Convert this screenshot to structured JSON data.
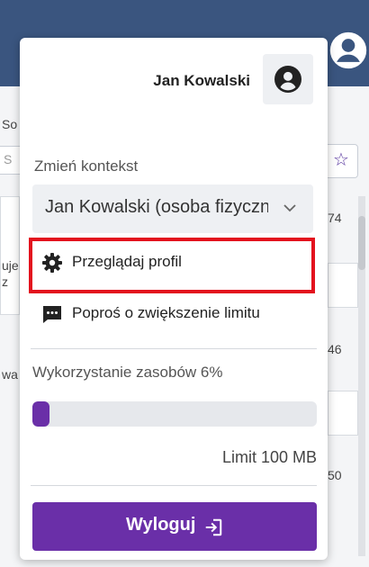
{
  "background": {
    "left_fragments": [
      "So",
      "S",
      "uje",
      "z",
      "wa"
    ],
    "numbers": [
      "74",
      "46",
      "50"
    ]
  },
  "dropdown": {
    "user_name": "Jan Kowalski",
    "context": {
      "label": "Zmień kontekst",
      "selected": "Jan Kowalski (osoba fizyczna)"
    },
    "menu": [
      {
        "label": "Przeglądaj profil",
        "icon": "gear-icon"
      },
      {
        "label": "Poproś o zwiększenie limitu",
        "icon": "message-icon"
      }
    ],
    "usage": {
      "label": "Wykorzystanie zasobów 6%",
      "fraction": 0.06,
      "limit_label": "Limit 100 MB"
    },
    "logout_label": "Wyloguj",
    "colors": {
      "accent": "#6a2fa8",
      "highlight": "#e3121e",
      "header": "#3a557f"
    }
  }
}
